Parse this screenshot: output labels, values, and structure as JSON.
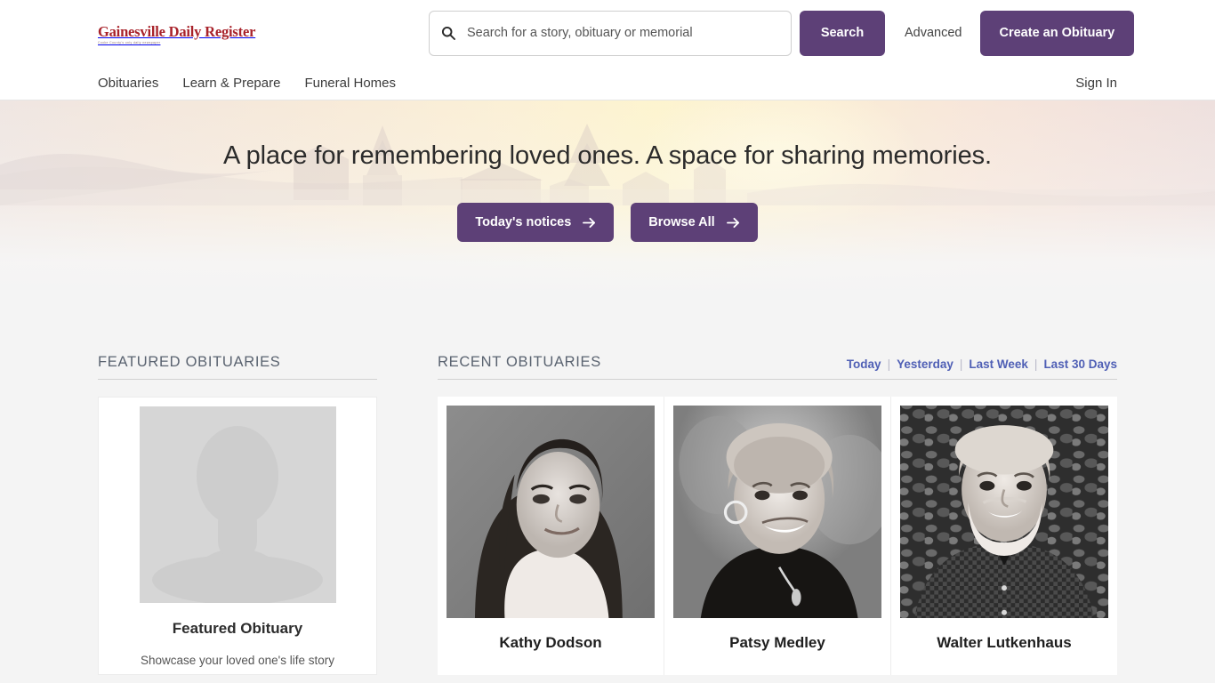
{
  "brand": {
    "logo_title": "Gainesville Daily Register",
    "logo_tagline": "Cooke County's only daily newspaper",
    "accent_purple": "#5d4077",
    "logo_red": "#a8222a",
    "filter_link_color": "#4f5fb5"
  },
  "search": {
    "placeholder": "Search for a story, obituary or memorial",
    "value": "",
    "search_button": "Search",
    "advanced_link": "Advanced",
    "create_button": "Create an Obituary",
    "icon": "search-icon"
  },
  "nav": {
    "items": [
      {
        "label": "Obituaries"
      },
      {
        "label": "Learn & Prepare"
      },
      {
        "label": "Funeral Homes"
      }
    ],
    "signin": "Sign In"
  },
  "hero": {
    "title": "A place for remembering loved ones. A space for sharing memories.",
    "buttons": [
      {
        "label": "Today's notices",
        "icon": "arrow-right-icon"
      },
      {
        "label": "Browse All",
        "icon": "arrow-right-icon"
      }
    ]
  },
  "featured": {
    "section_title": "FEATURED OBITUARIES",
    "card": {
      "image": "person-silhouette-placeholder",
      "name": "Featured Obituary",
      "subtitle": "Showcase your loved one's life story"
    }
  },
  "recent": {
    "section_title": "RECENT OBITUARIES",
    "filters": [
      {
        "label": "Today"
      },
      {
        "label": "Yesterday"
      },
      {
        "label": "Last Week"
      },
      {
        "label": "Last 30 Days"
      }
    ],
    "filter_separator": "|",
    "cards": [
      {
        "name": "Kathy Dodson",
        "photo": "portrait-woman-dark-hair-bw"
      },
      {
        "name": "Patsy Medley",
        "photo": "portrait-older-woman-bw"
      },
      {
        "name": "Walter Lutkenhaus",
        "photo": "portrait-bearded-man-bw"
      }
    ]
  }
}
